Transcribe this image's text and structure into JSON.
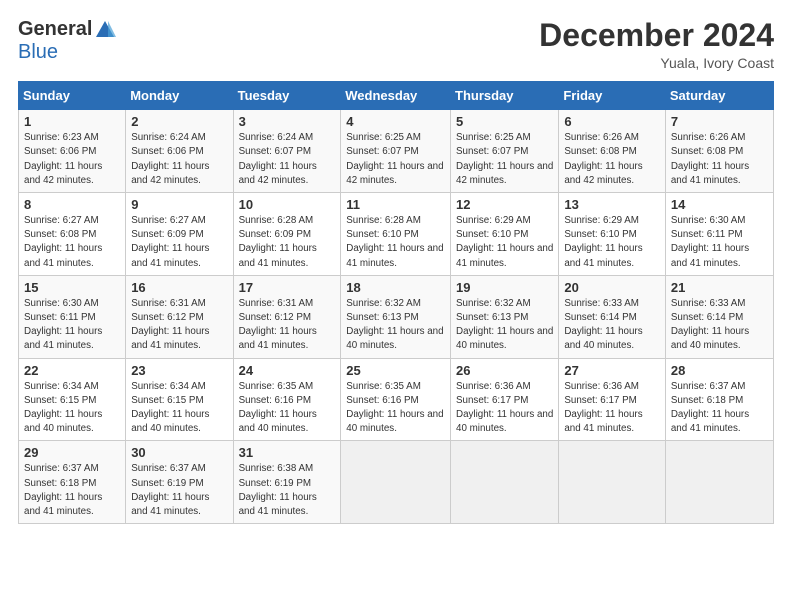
{
  "logo": {
    "general": "General",
    "blue": "Blue"
  },
  "header": {
    "month": "December 2024",
    "location": "Yuala, Ivory Coast"
  },
  "weekdays": [
    "Sunday",
    "Monday",
    "Tuesday",
    "Wednesday",
    "Thursday",
    "Friday",
    "Saturday"
  ],
  "weeks": [
    [
      {
        "day": "1",
        "sunrise": "6:23 AM",
        "sunset": "6:06 PM",
        "daylight": "11 hours and 42 minutes."
      },
      {
        "day": "2",
        "sunrise": "6:24 AM",
        "sunset": "6:06 PM",
        "daylight": "11 hours and 42 minutes."
      },
      {
        "day": "3",
        "sunrise": "6:24 AM",
        "sunset": "6:07 PM",
        "daylight": "11 hours and 42 minutes."
      },
      {
        "day": "4",
        "sunrise": "6:25 AM",
        "sunset": "6:07 PM",
        "daylight": "11 hours and 42 minutes."
      },
      {
        "day": "5",
        "sunrise": "6:25 AM",
        "sunset": "6:07 PM",
        "daylight": "11 hours and 42 minutes."
      },
      {
        "day": "6",
        "sunrise": "6:26 AM",
        "sunset": "6:08 PM",
        "daylight": "11 hours and 42 minutes."
      },
      {
        "day": "7",
        "sunrise": "6:26 AM",
        "sunset": "6:08 PM",
        "daylight": "11 hours and 41 minutes."
      }
    ],
    [
      {
        "day": "8",
        "sunrise": "6:27 AM",
        "sunset": "6:08 PM",
        "daylight": "11 hours and 41 minutes."
      },
      {
        "day": "9",
        "sunrise": "6:27 AM",
        "sunset": "6:09 PM",
        "daylight": "11 hours and 41 minutes."
      },
      {
        "day": "10",
        "sunrise": "6:28 AM",
        "sunset": "6:09 PM",
        "daylight": "11 hours and 41 minutes."
      },
      {
        "day": "11",
        "sunrise": "6:28 AM",
        "sunset": "6:10 PM",
        "daylight": "11 hours and 41 minutes."
      },
      {
        "day": "12",
        "sunrise": "6:29 AM",
        "sunset": "6:10 PM",
        "daylight": "11 hours and 41 minutes."
      },
      {
        "day": "13",
        "sunrise": "6:29 AM",
        "sunset": "6:10 PM",
        "daylight": "11 hours and 41 minutes."
      },
      {
        "day": "14",
        "sunrise": "6:30 AM",
        "sunset": "6:11 PM",
        "daylight": "11 hours and 41 minutes."
      }
    ],
    [
      {
        "day": "15",
        "sunrise": "6:30 AM",
        "sunset": "6:11 PM",
        "daylight": "11 hours and 41 minutes."
      },
      {
        "day": "16",
        "sunrise": "6:31 AM",
        "sunset": "6:12 PM",
        "daylight": "11 hours and 41 minutes."
      },
      {
        "day": "17",
        "sunrise": "6:31 AM",
        "sunset": "6:12 PM",
        "daylight": "11 hours and 41 minutes."
      },
      {
        "day": "18",
        "sunrise": "6:32 AM",
        "sunset": "6:13 PM",
        "daylight": "11 hours and 40 minutes."
      },
      {
        "day": "19",
        "sunrise": "6:32 AM",
        "sunset": "6:13 PM",
        "daylight": "11 hours and 40 minutes."
      },
      {
        "day": "20",
        "sunrise": "6:33 AM",
        "sunset": "6:14 PM",
        "daylight": "11 hours and 40 minutes."
      },
      {
        "day": "21",
        "sunrise": "6:33 AM",
        "sunset": "6:14 PM",
        "daylight": "11 hours and 40 minutes."
      }
    ],
    [
      {
        "day": "22",
        "sunrise": "6:34 AM",
        "sunset": "6:15 PM",
        "daylight": "11 hours and 40 minutes."
      },
      {
        "day": "23",
        "sunrise": "6:34 AM",
        "sunset": "6:15 PM",
        "daylight": "11 hours and 40 minutes."
      },
      {
        "day": "24",
        "sunrise": "6:35 AM",
        "sunset": "6:16 PM",
        "daylight": "11 hours and 40 minutes."
      },
      {
        "day": "25",
        "sunrise": "6:35 AM",
        "sunset": "6:16 PM",
        "daylight": "11 hours and 40 minutes."
      },
      {
        "day": "26",
        "sunrise": "6:36 AM",
        "sunset": "6:17 PM",
        "daylight": "11 hours and 40 minutes."
      },
      {
        "day": "27",
        "sunrise": "6:36 AM",
        "sunset": "6:17 PM",
        "daylight": "11 hours and 41 minutes."
      },
      {
        "day": "28",
        "sunrise": "6:37 AM",
        "sunset": "6:18 PM",
        "daylight": "11 hours and 41 minutes."
      }
    ],
    [
      {
        "day": "29",
        "sunrise": "6:37 AM",
        "sunset": "6:18 PM",
        "daylight": "11 hours and 41 minutes."
      },
      {
        "day": "30",
        "sunrise": "6:37 AM",
        "sunset": "6:19 PM",
        "daylight": "11 hours and 41 minutes."
      },
      {
        "day": "31",
        "sunrise": "6:38 AM",
        "sunset": "6:19 PM",
        "daylight": "11 hours and 41 minutes."
      },
      null,
      null,
      null,
      null
    ]
  ]
}
